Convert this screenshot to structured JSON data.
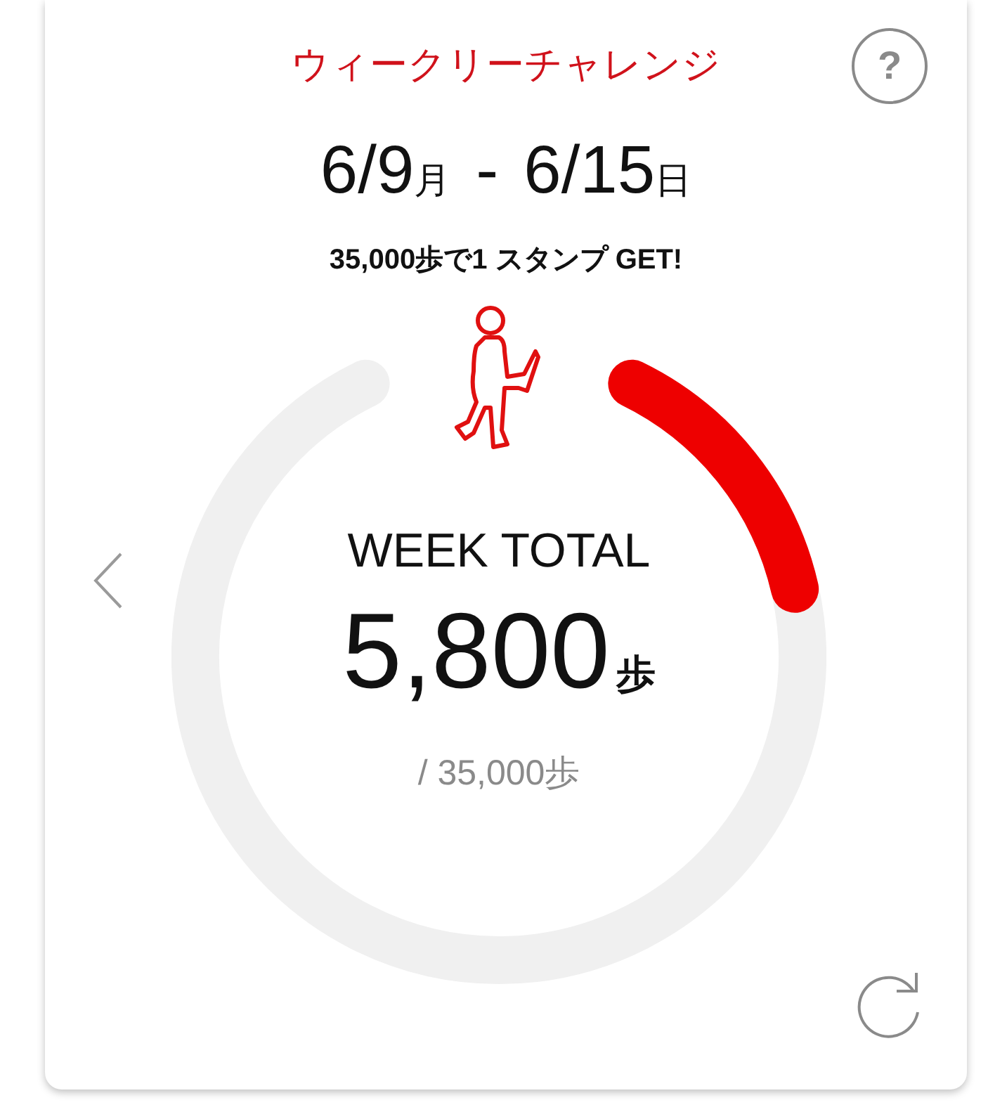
{
  "title": "ウィークリーチャレンジ",
  "help": {
    "label": "?"
  },
  "date_range": {
    "start": "6/9",
    "start_day": "月",
    "separator": "-",
    "end": "6/15",
    "end_day": "日"
  },
  "goal_text": "35,000歩で1 スタンプ GET!",
  "progress": {
    "label": "WEEK TOTAL",
    "value": "5,800",
    "unit": "歩",
    "goal": "/ 35,000歩"
  }
}
